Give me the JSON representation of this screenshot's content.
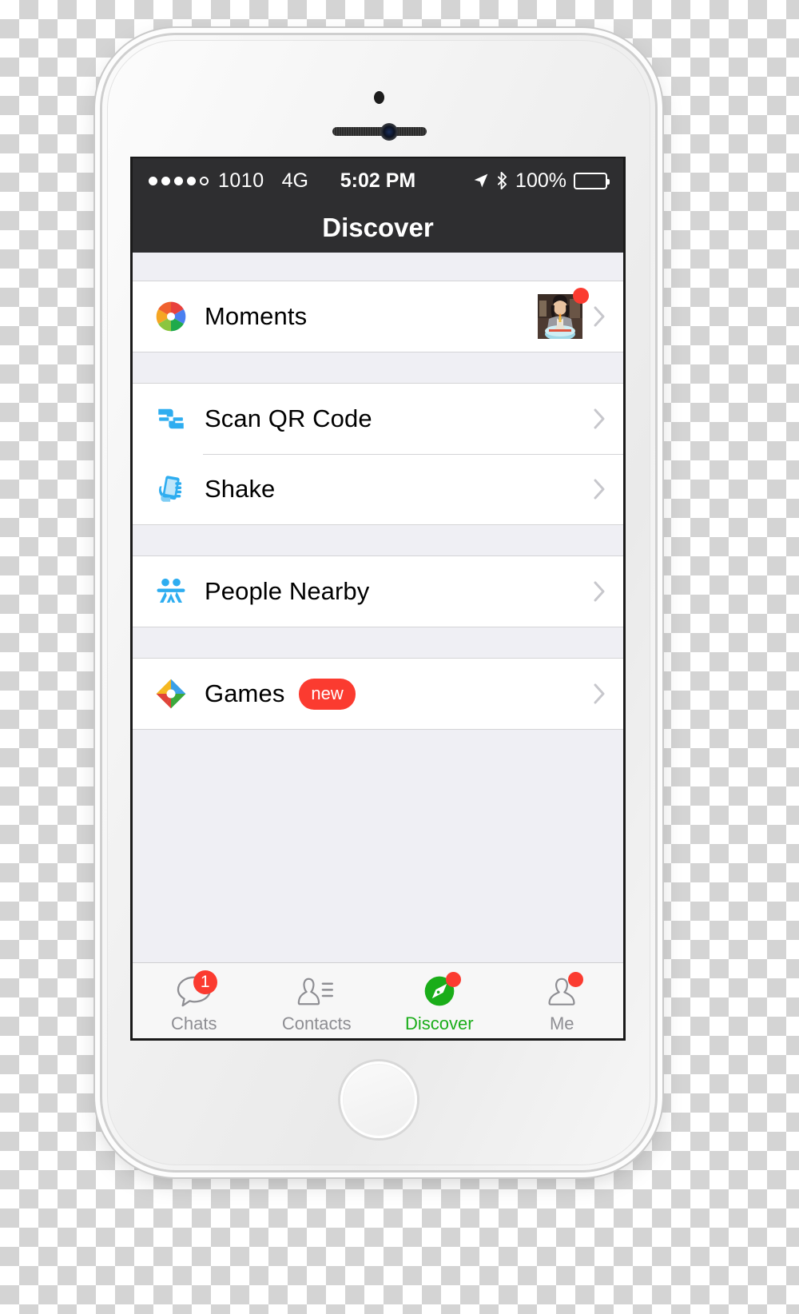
{
  "status_bar": {
    "signal_dots_filled": 4,
    "signal_dots_total": 5,
    "carrier": "1010",
    "network": "4G",
    "time": "5:02 PM",
    "battery_percent": "100%",
    "location_icon": "location-arrow-icon",
    "bluetooth_icon": "bluetooth-icon",
    "battery_icon": "battery-full-icon"
  },
  "nav": {
    "title": "Discover"
  },
  "list_groups": [
    {
      "rows": [
        {
          "label": "Moments",
          "icon": "moments-aperture-icon",
          "thumbnail": "moments-thumbnail",
          "badge_dot": true,
          "chevron": "chevron-right-icon"
        }
      ]
    },
    {
      "rows": [
        {
          "label": "Scan QR Code",
          "icon": "scan-qr-code-icon",
          "chevron": "chevron-right-icon"
        },
        {
          "label": "Shake",
          "icon": "shake-phone-icon",
          "chevron": "chevron-right-icon"
        }
      ]
    },
    {
      "rows": [
        {
          "label": "People Nearby",
          "icon": "people-nearby-icon",
          "chevron": "chevron-right-icon"
        }
      ]
    },
    {
      "rows": [
        {
          "label": "Games",
          "icon": "games-pinwheel-icon",
          "badge_text": "new",
          "chevron": "chevron-right-icon"
        }
      ]
    }
  ],
  "tabs": [
    {
      "label": "Chats",
      "icon": "chat-bubble-icon",
      "badge": "1",
      "active": false
    },
    {
      "label": "Contacts",
      "icon": "contacts-icon",
      "badge": "",
      "active": false
    },
    {
      "label": "Discover",
      "icon": "compass-icon",
      "badge": "dot",
      "active": true
    },
    {
      "label": "Me",
      "icon": "person-icon",
      "badge": "dot",
      "active": false
    }
  ],
  "colors": {
    "accent_green": "#1aad19",
    "badge_red": "#fb3b30",
    "status_bar_bg": "#2e2e30",
    "list_bg": "#efeff4",
    "icon_blue": "#2eadf0"
  },
  "device": {
    "home_button": "home-button",
    "earpiece": "earpiece-speaker",
    "front_camera": "front-camera",
    "proximity_sensor": "proximity-sensor"
  }
}
